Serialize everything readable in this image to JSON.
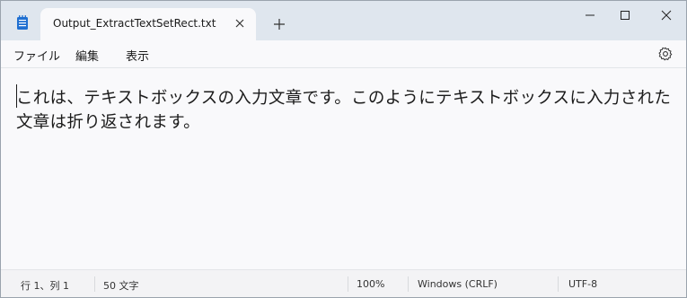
{
  "tab": {
    "title": "Output_ExtractTextSetRect.txt",
    "close_glyph": "✕",
    "add_glyph": "+"
  },
  "icons": {
    "app": "notepad-icon",
    "minimize": "minimize-icon",
    "maximize": "maximize-icon",
    "close": "close-icon",
    "settings": "gear-icon"
  },
  "menu": {
    "file": "ファイル",
    "edit": "編集",
    "view": "表示"
  },
  "editor": {
    "content": "これは、テキストボックスの入力文章です。このようにテキストボックスに入力された文章は折り返されます。"
  },
  "status": {
    "position": "行 1、列 1",
    "char_count": "50 文字",
    "zoom": "100%",
    "line_ending": "Windows (CRLF)",
    "encoding": "UTF-8"
  },
  "colors": {
    "titlebar": "#dfe6ee",
    "editor_bg": "#f9f9fb",
    "accent": "#1f6fd1"
  }
}
